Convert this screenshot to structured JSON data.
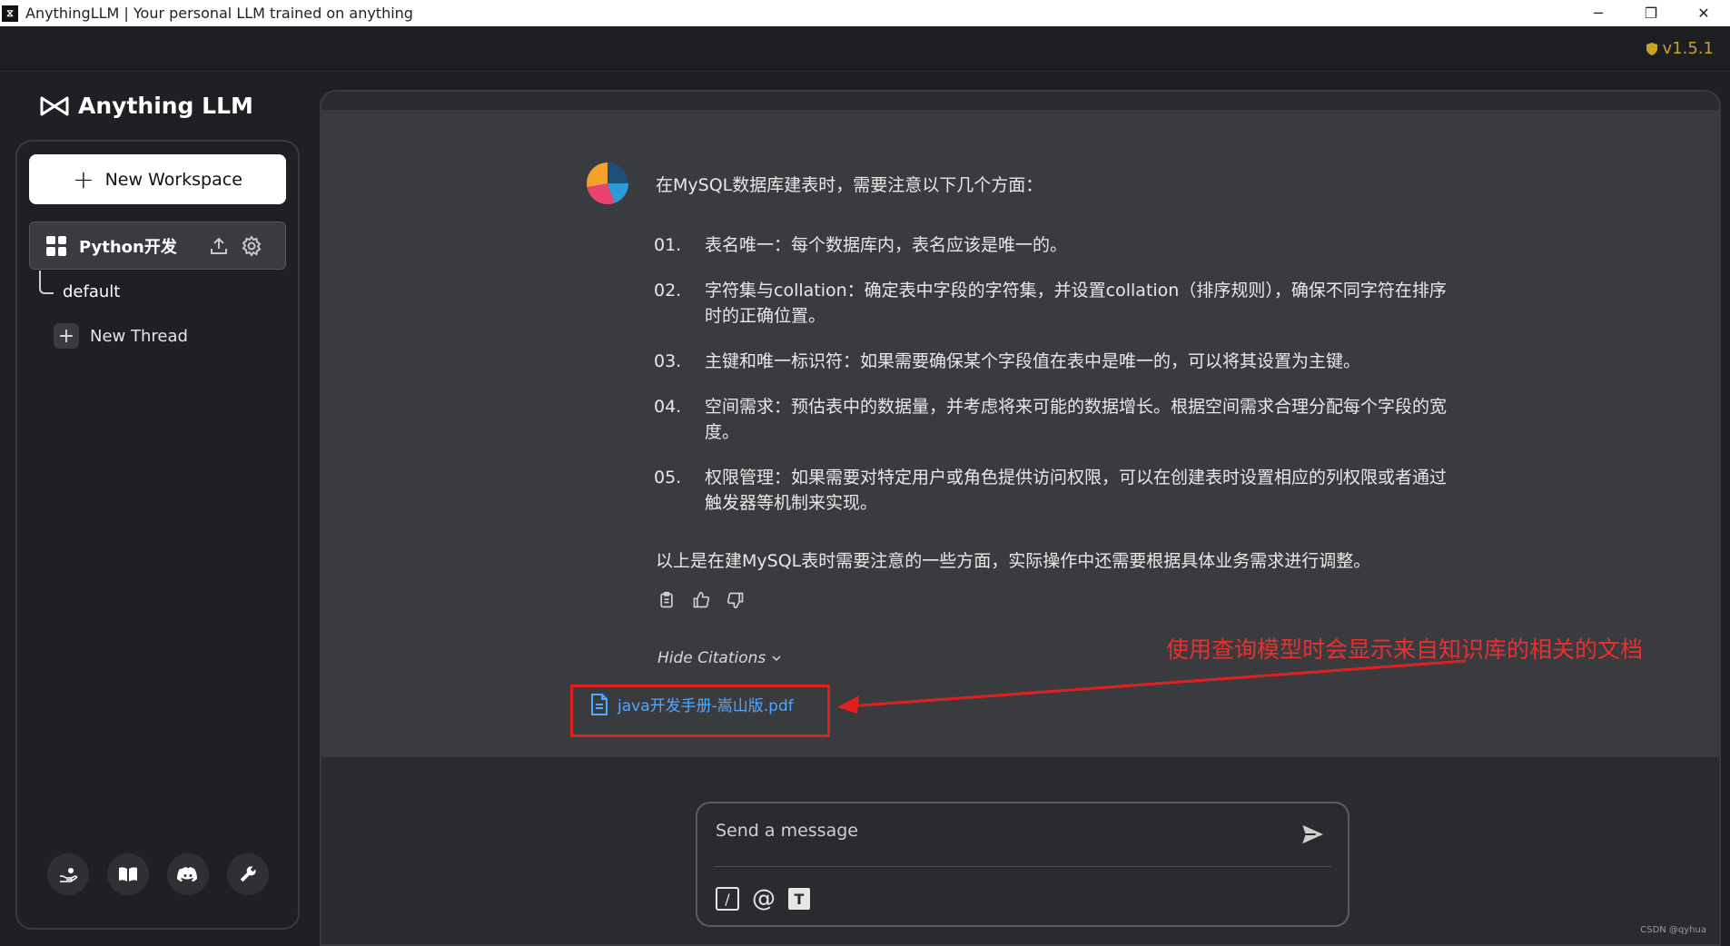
{
  "window": {
    "app_icon": "AnythingLLM-logo-icon",
    "title": "AnythingLLM | Your personal LLM trained on anything",
    "controls": [
      "minimize",
      "maximize",
      "close"
    ]
  },
  "header": {
    "version": "v1.5.1"
  },
  "sidebar": {
    "logo_text": "Anything LLM",
    "new_workspace_label": "New Workspace",
    "workspace": {
      "name": "Python开发"
    },
    "threads": [
      {
        "label": "default"
      }
    ],
    "new_thread_label": "New Thread",
    "footer_icons": [
      "community-hub-icon",
      "docs-icon",
      "discord-icon",
      "settings-wrench-icon"
    ]
  },
  "chat": {
    "intro": "在MySQL数据库建表时，需要注意以下几个方面：",
    "items": [
      {
        "num": "01.",
        "text": "表名唯一：每个数据库内，表名应该是唯一的。"
      },
      {
        "num": "02.",
        "text": "字符集与collation：确定表中字段的字符集，并设置collation（排序规则），确保不同字符在排序时的正确位置。"
      },
      {
        "num": "03.",
        "text": "主键和唯一标识符：如果需要确保某个字段值在表中是唯一的，可以将其设置为主键。"
      },
      {
        "num": "04.",
        "text": "空间需求：预估表中的数据量，并考虑将来可能的数据增长。根据空间需求合理分配每个字段的宽度。"
      },
      {
        "num": "05.",
        "text": "权限管理：如果需要对特定用户或角色提供访问权限，可以在创建表时设置相应的列权限或者通过触发器等机制来实现。"
      }
    ],
    "summary": "以上是在建MySQL表时需要注意的一些方面，实际操作中还需要根据具体业务需求进行调整。",
    "hide_citations_label": "Hide Citations",
    "citation_file": "java开发手册-嵩山版.pdf"
  },
  "annotation": {
    "text": "使用查询模型时会显示来自知识库的相关的文档",
    "color": "#e83030"
  },
  "input": {
    "placeholder": "Send a message"
  },
  "watermark": "CSDN @qyhua"
}
